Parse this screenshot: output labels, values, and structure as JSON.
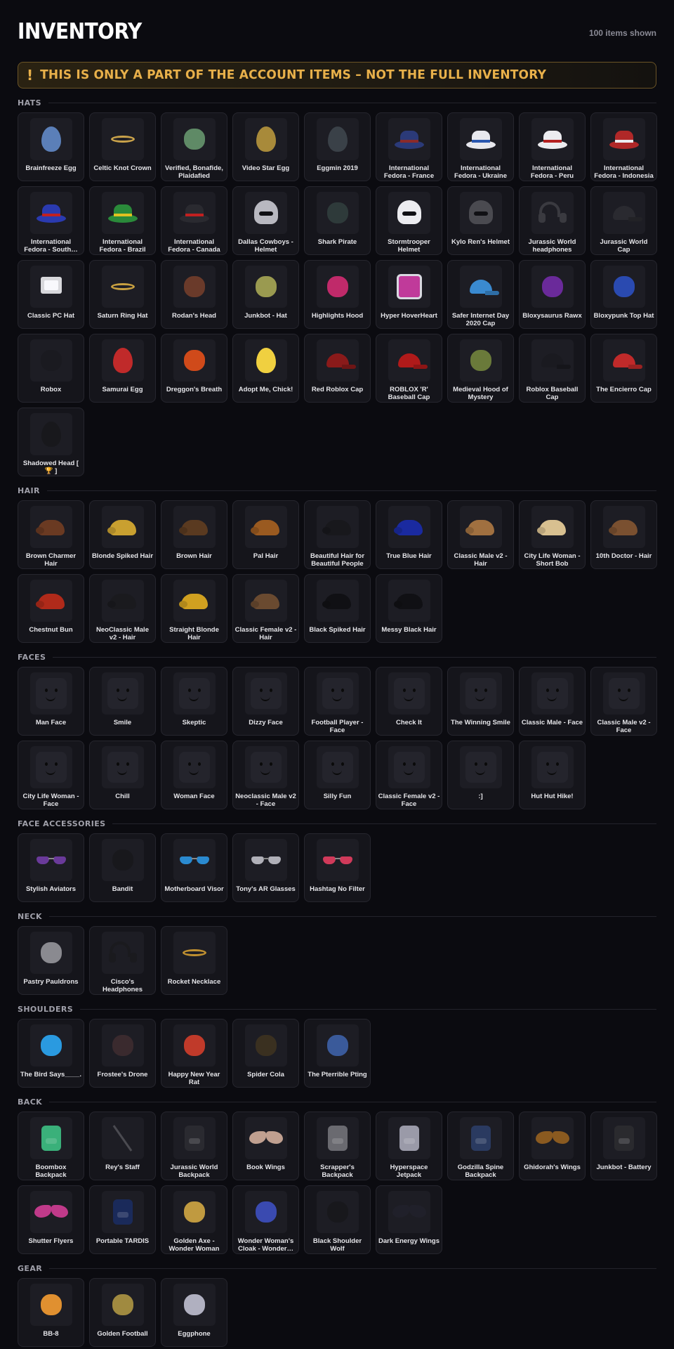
{
  "header": {
    "title": "INVENTORY",
    "count_text": "100 items shown"
  },
  "banner": {
    "icon": "!",
    "text": "THIS IS ONLY A PART OF THE ACCOUNT ITEMS – NOT THE FULL INVENTORY"
  },
  "sections": [
    {
      "label": "HATS",
      "items": [
        {
          "name": "Brainfreeze Egg",
          "icon": "egg-icon",
          "color": "#5b7fb8"
        },
        {
          "name": "Celtic Knot Crown",
          "icon": "crown-icon",
          "color": "#c9a24a"
        },
        {
          "name": "Verified, Bonafide, Plaidafied",
          "icon": "hat-icon",
          "color": "#5f8a66"
        },
        {
          "name": "Video Star Egg",
          "icon": "egg-icon",
          "color": "#a88a3a"
        },
        {
          "name": "Eggmin 2019",
          "icon": "egg-icon",
          "color": "#3a4148"
        },
        {
          "name": "International Fedora - France",
          "icon": "fedora-icon",
          "color": "#2b3a78",
          "band": "#8a2a2a"
        },
        {
          "name": "International Fedora - Ukraine",
          "icon": "fedora-icon",
          "color": "#e8e8ee",
          "band": "#2a57b0"
        },
        {
          "name": "International Fedora - Peru",
          "icon": "fedora-icon",
          "color": "#ececf0",
          "band": "#b52020"
        },
        {
          "name": "International Fedora - Indonesia",
          "icon": "fedora-icon",
          "color": "#b02828",
          "band": "#ececf0"
        },
        {
          "name": "International Fedora - South…",
          "icon": "fedora-icon",
          "color": "#2a3ab0",
          "band": "#c02020"
        },
        {
          "name": "International Fedora - Brazil",
          "icon": "fedora-icon",
          "color": "#2a8a3a",
          "band": "#e0c020"
        },
        {
          "name": "International Fedora - Canada",
          "icon": "fedora-icon",
          "color": "#2a2a30",
          "band": "#c02020"
        },
        {
          "name": "Dallas Cowboys - Helmet",
          "icon": "helmet-icon",
          "color": "#b8b8c0"
        },
        {
          "name": "Shark Pirate",
          "icon": "hat-icon",
          "color": "#2e3a3a"
        },
        {
          "name": "Stormtrooper Helmet",
          "icon": "helmet-icon",
          "color": "#ececf0"
        },
        {
          "name": "Kylo Ren's Helmet",
          "icon": "helmet-icon",
          "color": "#4a4a50"
        },
        {
          "name": "Jurassic World headphones",
          "icon": "headphones-icon",
          "color": "#3a3a40"
        },
        {
          "name": "Jurassic World Cap",
          "icon": "cap-icon",
          "color": "#2a2a30"
        },
        {
          "name": "Classic PC Hat",
          "icon": "monitor-icon",
          "color": "#d8d8dc"
        },
        {
          "name": "Saturn Ring Hat",
          "icon": "ring-icon",
          "color": "#c8a040"
        },
        {
          "name": "Rodan's Head",
          "icon": "creature-icon",
          "color": "#6a3a2a"
        },
        {
          "name": "Junkbot - Hat",
          "icon": "hat-icon",
          "color": "#9a9a50"
        },
        {
          "name": "Highlights Hood",
          "icon": "hood-icon",
          "color": "#c02a6a"
        },
        {
          "name": "Hyper HoverHeart",
          "icon": "heart-icon",
          "color": "#c03a9a"
        },
        {
          "name": "Safer Internet Day 2020 Cap",
          "icon": "cap-icon",
          "color": "#3a8ad0"
        },
        {
          "name": "Bloxysaurus Rawx",
          "icon": "creature-icon",
          "color": "#6a2a9a"
        },
        {
          "name": "Bloxypunk Top Hat",
          "icon": "tophat-icon",
          "color": "#2a4ab0"
        },
        {
          "name": "Robox",
          "icon": "box-icon",
          "color": "#1a1a20"
        },
        {
          "name": "Samurai Egg",
          "icon": "egg-icon",
          "color": "#c02a2a"
        },
        {
          "name": "Dreggon's Breath",
          "icon": "potion-icon",
          "color": "#d04a1a"
        },
        {
          "name": "Adopt Me, Chick!",
          "icon": "chick-icon",
          "color": "#f0d040"
        },
        {
          "name": "Red Roblox Cap",
          "icon": "cap-icon",
          "color": "#8a1a1a"
        },
        {
          "name": "ROBLOX 'R' Baseball Cap",
          "icon": "cap-icon",
          "color": "#b01a1a"
        },
        {
          "name": "Medieval Hood of Mystery",
          "icon": "hood-icon",
          "color": "#6a7a3a"
        },
        {
          "name": "Roblox Baseball Cap",
          "icon": "cap-icon",
          "color": "#1a1a20"
        },
        {
          "name": "The Encierro Cap",
          "icon": "cap-icon",
          "color": "#c02a2a"
        },
        {
          "name": "Shadowed Head [ 🏆 ]",
          "icon": "head-icon",
          "color": "#18181c"
        }
      ]
    },
    {
      "label": "HAIR",
      "items": [
        {
          "name": "Brown Charmer Hair",
          "icon": "hair-icon",
          "color": "#6a3a22"
        },
        {
          "name": "Blonde Spiked Hair",
          "icon": "hair-icon",
          "color": "#c9a030"
        },
        {
          "name": "Brown Hair",
          "icon": "hair-icon",
          "color": "#5a3a20"
        },
        {
          "name": "Pal Hair",
          "icon": "hair-icon",
          "color": "#9a5a20"
        },
        {
          "name": "Beautiful Hair for Beautiful People",
          "icon": "hair-icon",
          "color": "#18181c"
        },
        {
          "name": "True Blue Hair",
          "icon": "hair-icon",
          "color": "#1a2aa0"
        },
        {
          "name": "Classic Male v2 - Hair",
          "icon": "hair-icon",
          "color": "#a07040"
        },
        {
          "name": "City Life Woman - Short Bob",
          "icon": "hair-icon",
          "color": "#d8c090"
        },
        {
          "name": "10th Doctor - Hair",
          "icon": "hair-icon",
          "color": "#7a5030"
        },
        {
          "name": "Chestnut Bun",
          "icon": "hair-icon",
          "color": "#b02a1a"
        },
        {
          "name": "NeoClassic Male v2 - Hair",
          "icon": "hair-icon",
          "color": "#1a1a1e"
        },
        {
          "name": "Straight Blonde Hair",
          "icon": "hair-icon",
          "color": "#d0a020"
        },
        {
          "name": "Classic Female v2 - Hair",
          "icon": "hair-icon",
          "color": "#6a4a30"
        },
        {
          "name": "Black Spiked Hair",
          "icon": "hair-icon",
          "color": "#101014"
        },
        {
          "name": "Messy Black Hair",
          "icon": "hair-icon",
          "color": "#101014"
        }
      ]
    },
    {
      "label": "FACES",
      "items": [
        {
          "name": "Man Face",
          "icon": "face-icon",
          "color": "#24242c"
        },
        {
          "name": "Smile",
          "icon": "face-icon",
          "color": "#24242c"
        },
        {
          "name": "Skeptic",
          "icon": "face-icon",
          "color": "#24242c"
        },
        {
          "name": "Dizzy Face",
          "icon": "face-icon",
          "color": "#24242c"
        },
        {
          "name": "Football Player - Face",
          "icon": "face-icon",
          "color": "#24242c"
        },
        {
          "name": "Check It",
          "icon": "face-icon",
          "color": "#24242c"
        },
        {
          "name": "The Winning Smile",
          "icon": "face-icon",
          "color": "#24242c"
        },
        {
          "name": "Classic Male - Face",
          "icon": "face-icon",
          "color": "#24242c"
        },
        {
          "name": "Classic Male v2 - Face",
          "icon": "face-icon",
          "color": "#24242c"
        },
        {
          "name": "City Life Woman - Face",
          "icon": "face-icon",
          "color": "#24242c"
        },
        {
          "name": "Chill",
          "icon": "face-icon",
          "color": "#24242c"
        },
        {
          "name": "Woman Face",
          "icon": "face-icon",
          "color": "#24242c"
        },
        {
          "name": "Neoclassic Male v2 - Face",
          "icon": "face-icon",
          "color": "#24242c"
        },
        {
          "name": "Silly Fun",
          "icon": "face-icon",
          "color": "#24242c"
        },
        {
          "name": "Classic Female v2 - Face",
          "icon": "face-icon",
          "color": "#24242c"
        },
        {
          "name": ":]",
          "icon": "face-icon",
          "color": "#24242c"
        },
        {
          "name": "Hut Hut Hike!",
          "icon": "face-icon",
          "color": "#24242c"
        }
      ]
    },
    {
      "label": "FACE ACCESSORIES",
      "items": [
        {
          "name": "Stylish Aviators",
          "icon": "glasses-icon",
          "color": "#6a3a9a"
        },
        {
          "name": "Bandit",
          "icon": "bandana-icon",
          "color": "#18181c"
        },
        {
          "name": "Motherboard Visor",
          "icon": "visor-icon",
          "color": "#2a8ad0"
        },
        {
          "name": "Tony's AR Glasses",
          "icon": "glasses-icon",
          "color": "#b0b0b8"
        },
        {
          "name": "Hashtag No Filter",
          "icon": "glasses-icon",
          "color": "#d03a5a"
        }
      ]
    },
    {
      "label": "NECK",
      "items": [
        {
          "name": "Pastry Pauldrons",
          "icon": "pauldron-icon",
          "color": "#8a8a90"
        },
        {
          "name": "Cisco's Headphones",
          "icon": "headphones-icon",
          "color": "#1a1a1e"
        },
        {
          "name": "Rocket Necklace",
          "icon": "necklace-icon",
          "color": "#c09030"
        }
      ]
    },
    {
      "label": "SHOULDERS",
      "items": [
        {
          "name": "The Bird Says____.",
          "icon": "bird-icon",
          "color": "#2a9ae0"
        },
        {
          "name": "Frostee's Drone",
          "icon": "drone-icon",
          "color": "#3a2a2e"
        },
        {
          "name": "Happy New Year Rat",
          "icon": "rat-icon",
          "color": "#c03a2a"
        },
        {
          "name": "Spider Cola",
          "icon": "spider-icon",
          "color": "#3a3020"
        },
        {
          "name": "The Pterrible Pting",
          "icon": "creature-icon",
          "color": "#3a5a9a"
        }
      ]
    },
    {
      "label": "BACK",
      "items": [
        {
          "name": "Boombox Backpack",
          "icon": "boombox-icon",
          "color": "#3ab07a"
        },
        {
          "name": "Rey's Staff",
          "icon": "staff-icon",
          "color": "#4a4a50"
        },
        {
          "name": "Jurassic World Backpack",
          "icon": "backpack-icon",
          "color": "#2a2a30"
        },
        {
          "name": "Book Wings",
          "icon": "wings-icon",
          "color": "#c0a090"
        },
        {
          "name": "Scrapper's Backpack",
          "icon": "backpack-icon",
          "color": "#6a6a70"
        },
        {
          "name": "Hyperspace Jetpack",
          "icon": "jetpack-icon",
          "color": "#9a9aa8"
        },
        {
          "name": "Godzilla Spine Backpack",
          "icon": "backpack-icon",
          "color": "#2a3a60"
        },
        {
          "name": "Ghidorah's Wings",
          "icon": "wings-icon",
          "color": "#8a5a20"
        },
        {
          "name": "Junkbot - Battery",
          "icon": "battery-icon",
          "color": "#2a2a2e"
        },
        {
          "name": "Shutter Flyers",
          "icon": "butterfly-icon",
          "color": "#c03a8a"
        },
        {
          "name": "Portable TARDIS",
          "icon": "tardis-icon",
          "color": "#1a2a5a"
        },
        {
          "name": "Golden Axe - Wonder Woman",
          "icon": "axe-icon",
          "color": "#c09a40"
        },
        {
          "name": "Wonder Woman's Cloak - Wonder…",
          "icon": "cloak-icon",
          "color": "#3a4ab0"
        },
        {
          "name": "Black Shoulder Wolf",
          "icon": "wolf-icon",
          "color": "#18181c"
        },
        {
          "name": "Dark Energy Wings",
          "icon": "wings-icon",
          "color": "#20202a"
        }
      ]
    },
    {
      "label": "GEAR",
      "items": [
        {
          "name": "BB-8",
          "icon": "robot-icon",
          "color": "#e09030"
        },
        {
          "name": "Golden Football",
          "icon": "football-icon",
          "color": "#a08a40"
        },
        {
          "name": "Eggphone",
          "icon": "phone-icon",
          "color": "#b0b0c0"
        }
      ]
    }
  ]
}
